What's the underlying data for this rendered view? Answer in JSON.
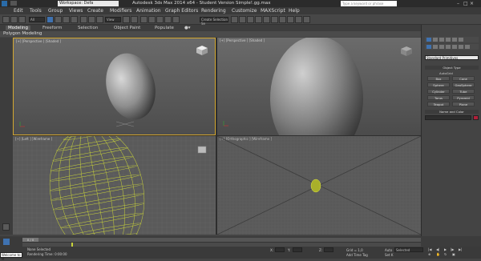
{
  "title": {
    "workspace": "Workspace: Defa",
    "window_title": "Autodesk 3ds Max 2014 x64 - Student Version   Simple!.gg.max",
    "search_placeholder": "Type a keyword or phrase"
  },
  "menu": [
    "Edit",
    "Tools",
    "Group",
    "Views",
    "Create",
    "Modifiers",
    "Animation",
    "Graph Editors",
    "Rendering",
    "Customize",
    "MAXScript",
    "Help"
  ],
  "toolbar": {
    "selection_filter": "All",
    "coord": "View",
    "named_sel": "Create Selection Se"
  },
  "ribbon": {
    "tabs": [
      "Modeling",
      "Freeform",
      "Selection",
      "Object Paint",
      "Populate"
    ],
    "subtitle": "Polygon Modeling"
  },
  "viewports": {
    "top_left": "[+] [Perspective ] [Shaded ]",
    "top_right": "[+] [Perspective ] [Shaded ]",
    "bottom_left": "[+] [Left ] [Wireframe ]",
    "bottom_right": "[+] [Orthographic ] [Wireframe ]"
  },
  "command_panel": {
    "category": "Standard Primitives",
    "object_type_header": "Object Type",
    "autogrid": "AutoGrid",
    "buttons": [
      "Box",
      "Cone",
      "Sphere",
      "GeoSphere",
      "Cylinder",
      "Tube",
      "Torus",
      "Pyramid",
      "Teapot",
      "Plane"
    ],
    "name_color_header": "Name and Color",
    "accent_color": "#b0203a"
  },
  "timeline": {
    "frame": "0 / 0",
    "status_selected": "None Selected",
    "status_render": "Rendering Time: 0:00:00",
    "welcome": "Welcome to M",
    "x_label": "X:",
    "y_label": "Y:",
    "z_label": "Z:",
    "grid": "Grid = 1,0",
    "add_time_tag": "Add Time Tag",
    "auto": "Auto",
    "set_key": "Set K",
    "key_filter": "Selected"
  },
  "colors": {
    "wire_yellow": "#c8d23a",
    "viewport_bg": "#595959",
    "active_border": "#d4a830"
  }
}
